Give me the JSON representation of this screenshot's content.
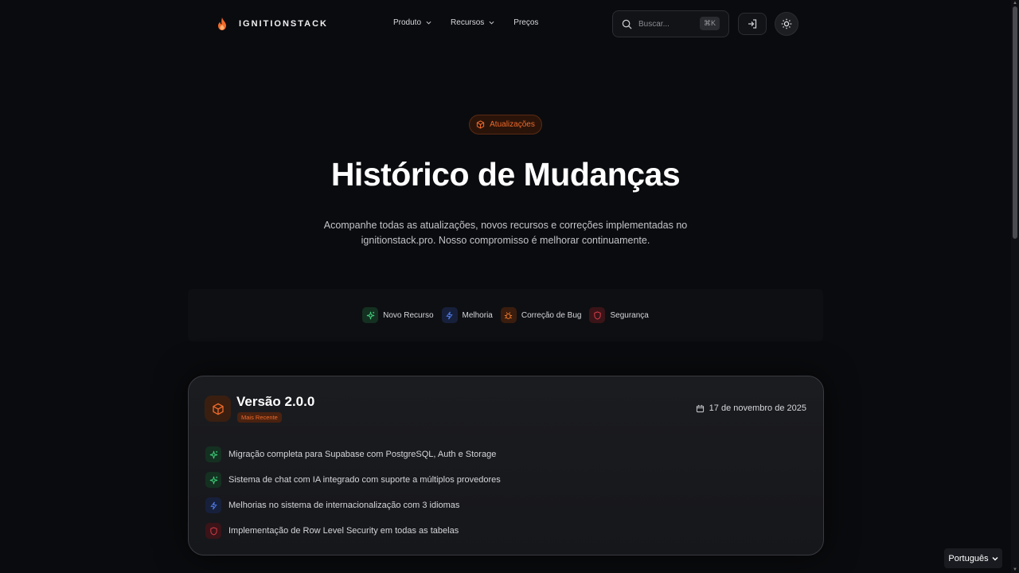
{
  "header": {
    "brand": "IGNITIONSTACK",
    "nav": [
      {
        "label": "Produto",
        "has_dropdown": true
      },
      {
        "label": "Recursos",
        "has_dropdown": true
      },
      {
        "label": "Preços",
        "has_dropdown": false
      }
    ],
    "search": {
      "placeholder": "Buscar...",
      "shortcut": "⌘K"
    },
    "icons": {
      "login": "login-icon",
      "theme": "sun-icon"
    }
  },
  "hero": {
    "badge": "Atualizações",
    "title": "Histórico de Mudanças",
    "subtitle_line1": "Acompanhe todas as atualizações, novos recursos e correções implementadas no",
    "subtitle_line2": "ignitionstack.pro. Nosso compromisso é melhorar continuamente."
  },
  "legend": [
    {
      "label": "Novo Recurso",
      "icon": "sparkles-icon",
      "color": "#3ecf7a"
    },
    {
      "label": "Melhoria",
      "icon": "zap-icon",
      "color": "#4f7cf0"
    },
    {
      "label": "Correção de Bug",
      "icon": "bug-icon",
      "color": "#f07a2a"
    },
    {
      "label": "Segurança",
      "icon": "shield-icon",
      "color": "#e0404f"
    }
  ],
  "release": {
    "version": "Versão 2.0.0",
    "badge": "Mais Recente",
    "date": "17 de novembro de 2025",
    "changes": [
      {
        "text": "Migração completa para Supabase com PostgreSQL, Auth e Storage",
        "type": "feature"
      },
      {
        "text": "Sistema de chat com IA integrado com suporte a múltiplos provedores",
        "type": "feature"
      },
      {
        "text": "Melhorias no sistema de internacionalização com 3 idiomas",
        "type": "improvement"
      },
      {
        "text": "Implementação de Row Level Security em todas as tabelas",
        "type": "security"
      }
    ]
  },
  "language_select": {
    "value": "Português"
  },
  "colors": {
    "accent": "#f06a2a",
    "background": "#0a0b0e"
  }
}
